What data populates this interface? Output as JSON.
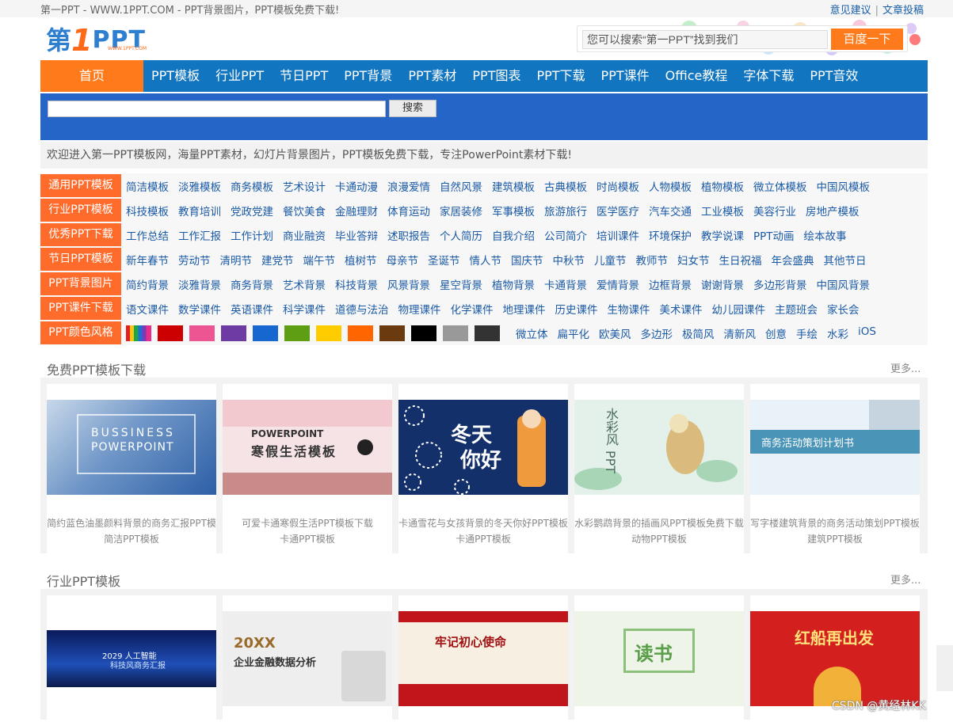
{
  "topbar": {
    "site_title": "第一PPT - WWW.1PPT.COM - PPT背景图片，PPT模板免费下载!",
    "feedback": "意见建议",
    "sep": "|",
    "submit": "文章投稿"
  },
  "logo": {
    "part1": "第",
    "part2": "1",
    "part3": "PPT",
    "sub": "WWW.1PPT.COM"
  },
  "search": {
    "placeholder": "您可以搜索“第一PPT”找到我们",
    "button": "百度一下"
  },
  "nav": {
    "home": "首页",
    "items": [
      "PPT模板",
      "行业PPT",
      "节日PPT",
      "PPT背景",
      "PPT素材",
      "PPT图表",
      "PPT下载",
      "PPT课件",
      "Office教程",
      "字体下载",
      "PPT音效"
    ]
  },
  "site_search": {
    "button": "搜索"
  },
  "welcome": "欢迎进入第一PPT模板网，海量PPT素材，幻灯片背景图片，PPT模板免费下载，专注PowerPoint素材下载!",
  "categories": [
    {
      "tag": "通用PPT模板",
      "links": [
        "简洁模板",
        "淡雅模板",
        "商务模板",
        "艺术设计",
        "卡通动漫",
        "浪漫爱情",
        "自然风景",
        "建筑模板",
        "古典模板",
        "时尚模板",
        "人物模板",
        "植物模板",
        "微立体模板",
        "中国风模板"
      ]
    },
    {
      "tag": "行业PPT模板",
      "links": [
        "科技模板",
        "教育培训",
        "党政党建",
        "餐饮美食",
        "金融理财",
        "体育运动",
        "家居装修",
        "军事模板",
        "旅游旅行",
        "医学医疗",
        "汽车交通",
        "工业模板",
        "美容行业",
        "房地产模板"
      ]
    },
    {
      "tag": "优秀PPT下载",
      "links": [
        "工作总结",
        "工作汇报",
        "工作计划",
        "商业融资",
        "毕业答辩",
        "述职报告",
        "个人简历",
        "自我介绍",
        "公司简介",
        "培训课件",
        "环境保护",
        "教学说课",
        "PPT动画",
        "绘本故事"
      ]
    },
    {
      "tag": "节日PPT模板",
      "links": [
        "新年春节",
        "劳动节",
        "清明节",
        "建党节",
        "端午节",
        "植树节",
        "母亲节",
        "圣诞节",
        "情人节",
        "国庆节",
        "中秋节",
        "儿童节",
        "教师节",
        "妇女节",
        "生日祝福",
        "年会盛典",
        "其他节日"
      ]
    },
    {
      "tag": "PPT背景图片",
      "links": [
        "简约背景",
        "淡雅背景",
        "商务背景",
        "艺术背景",
        "科技背景",
        "风景背景",
        "星空背景",
        "植物背景",
        "卡通背景",
        "爱情背景",
        "边框背景",
        "谢谢背景",
        "多边形背景",
        "中国风背景"
      ]
    },
    {
      "tag": "PPT课件下载",
      "links": [
        "语文课件",
        "数学课件",
        "英语课件",
        "科学课件",
        "道德与法治",
        "物理课件",
        "化学课件",
        "地理课件",
        "历史课件",
        "生物课件",
        "美术课件",
        "幼儿园课件",
        "主题班会",
        "家长会"
      ]
    }
  ],
  "color_row": {
    "tag": "PPT颜色风格",
    "swatch_colors": [
      "rainbow",
      "#cc0000",
      "#ec5591",
      "#6e3aa4",
      "#1667d0",
      "#5e9e12",
      "#ffcc00",
      "#ff6600",
      "#6b3a0e",
      "#000000",
      "#999999",
      "#333333"
    ],
    "links": [
      "微立体",
      "扁平化",
      "欧美风",
      "多边形",
      "极简风",
      "清新风",
      "创意",
      "手绘",
      "水彩",
      "iOS"
    ]
  },
  "section1": {
    "title": "免费PPT模板下载",
    "more": "更多...",
    "cards": [
      {
        "thumb_line1": "BUSSINESS",
        "thumb_line2": "POWERPOINT",
        "cap1": "简约蓝色油墨颜料背景的商务汇报PPT模",
        "cap2": "简洁PPT模板"
      },
      {
        "thumb_line1": "POWERPOINT",
        "thumb_line2": "寒假生活模板",
        "cap1": "可爱卡通寒假生活PPT模板下载",
        "cap2": "卡通PPT模板"
      },
      {
        "thumb_line1": "冬天",
        "thumb_line2": "你好",
        "cap1": "卡通雪花与女孩背景的冬天你好PPT模板",
        "cap2": "卡通PPT模板"
      },
      {
        "thumb_line1": "水彩风",
        "thumb_line2": "PPT",
        "cap1": "水彩鹦鹉背景的插画风PPT模板免费下载",
        "cap2": "动物PPT模板"
      },
      {
        "thumb_line1": "商务活动策划计划书",
        "thumb_line2": "",
        "cap1": "写字楼建筑背景的商务活动策划PPT模板",
        "cap2": "建筑PPT模板"
      }
    ]
  },
  "section2": {
    "title": "行业PPT模板",
    "more": "更多...",
    "cards": [
      {
        "thumb_line1": "2029 人工智能",
        "thumb_line2": "科技风商务汇报"
      },
      {
        "thumb_line1": "20XX",
        "thumb_line2": "企业金融数据分析"
      },
      {
        "thumb_line1": "牢记初心使命",
        "thumb_line2": ""
      },
      {
        "thumb_line1": "读书",
        "thumb_line2": ""
      },
      {
        "thumb_line1": "红船再出发",
        "thumb_line2": ""
      }
    ]
  },
  "watermark": "CSDN @黄经林KK"
}
